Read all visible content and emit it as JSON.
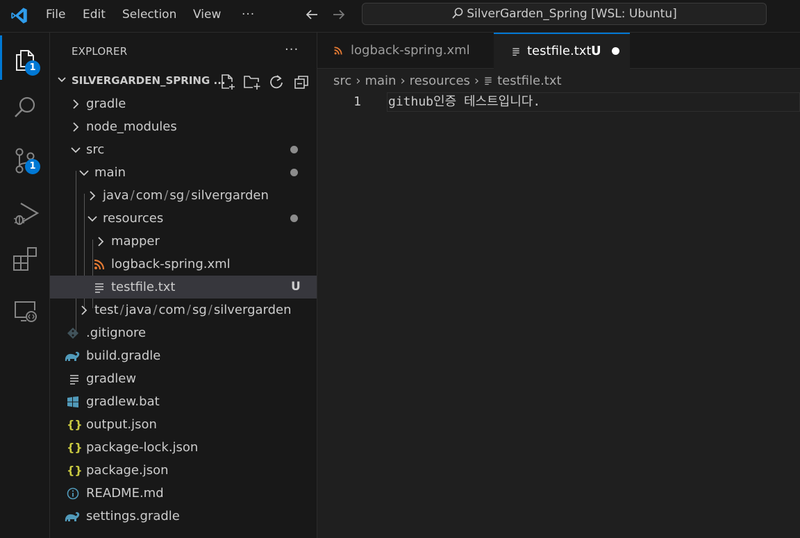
{
  "titlebar": {
    "menu": [
      "File",
      "Edit",
      "Selection",
      "View",
      "···"
    ],
    "search_text": "SilverGarden_Spring [WSL: Ubuntu]",
    "icons": [
      "vscode-logo-icon",
      "back-arrow-icon",
      "forward-arrow-icon",
      "search-icon"
    ]
  },
  "activitybar": {
    "items": [
      {
        "name": "explorer",
        "icon": "files-icon",
        "badge": "1",
        "active": true
      },
      {
        "name": "search",
        "icon": "search-icon"
      },
      {
        "name": "source-control",
        "icon": "source-control-icon",
        "badge": "1"
      },
      {
        "name": "run-debug",
        "icon": "run-debug-icon"
      },
      {
        "name": "extensions",
        "icon": "extensions-icon"
      },
      {
        "name": "remote-explorer",
        "icon": "remote-explorer-icon"
      }
    ]
  },
  "sidebar": {
    "title": "EXPLORER",
    "more": "···",
    "section_title": "SILVERGARDEN_SPRING ...",
    "tree": [
      {
        "label": "gradle",
        "icon": "chevron-right"
      },
      {
        "label": "node_modules",
        "icon": "chevron-right"
      },
      {
        "label": "src",
        "icon": "chevron-down",
        "modified": true
      },
      {
        "label": "main",
        "icon": "chevron-down",
        "modified": true
      },
      {
        "label": "java / com / sg / silvergarden",
        "parts": [
          "java",
          "com",
          "sg",
          "silvergarden"
        ],
        "icon": "chevron-right"
      },
      {
        "label": "resources",
        "icon": "chevron-down",
        "modified": true
      },
      {
        "label": "mapper",
        "icon": "chevron-right"
      },
      {
        "label": "logback-spring.xml",
        "icon": "xml-rss-icon"
      },
      {
        "label": "testfile.txt",
        "icon": "text-file-icon",
        "status": "U",
        "selected": true
      },
      {
        "label": "test / java / com / sg / silvergarden",
        "parts": [
          "test",
          "java",
          "com",
          "sg",
          "silvergarden"
        ],
        "icon": "chevron-right"
      },
      {
        "label": ".gitignore",
        "icon": "git-icon"
      },
      {
        "label": "build.gradle",
        "icon": "gradle-elephant-icon"
      },
      {
        "label": "gradlew",
        "icon": "text-file-icon"
      },
      {
        "label": "gradlew.bat",
        "icon": "windows-icon"
      },
      {
        "label": "output.json",
        "icon": "json-braces-icon"
      },
      {
        "label": "package-lock.json",
        "icon": "json-braces-icon"
      },
      {
        "label": "package.json",
        "icon": "json-braces-icon"
      },
      {
        "label": "README.md",
        "icon": "info-icon"
      },
      {
        "label": "settings.gradle",
        "icon": "gradle-elephant-icon"
      }
    ]
  },
  "editor": {
    "tabs": [
      {
        "label": "logback-spring.xml",
        "active": false
      },
      {
        "label": "testfile.txt",
        "status": "U",
        "dirty": true,
        "active": true
      }
    ],
    "breadcrumb": [
      "src",
      "main",
      "resources",
      "testfile.txt"
    ],
    "lines": [
      {
        "number": "1",
        "text": "github인증 테스트입니다."
      }
    ]
  },
  "colors": {
    "accent": "#0078d4",
    "xml_icon": "#e37933",
    "json_icon": "#cbcb41",
    "gradle_icon": "#519aba",
    "background": "#1f1f1f",
    "sidebar": "#181818"
  }
}
